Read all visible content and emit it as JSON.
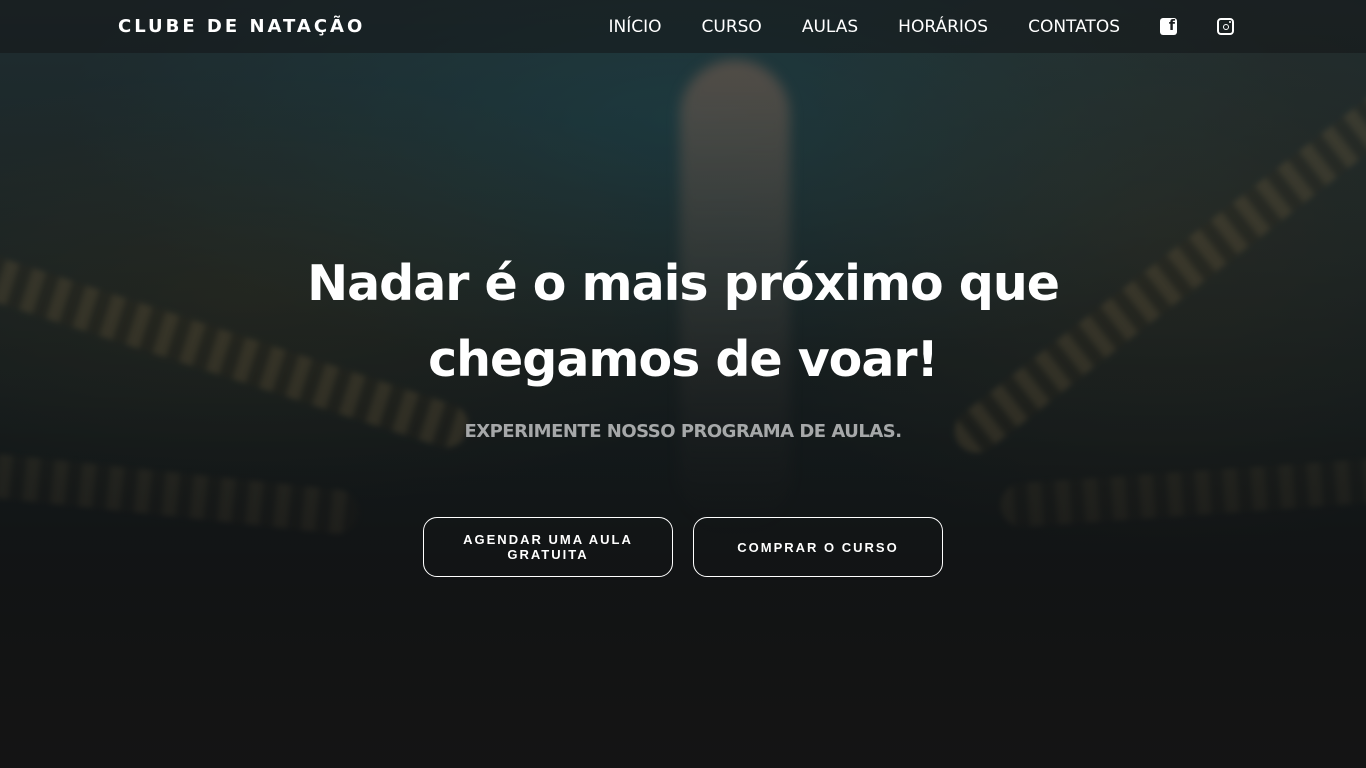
{
  "navbar": {
    "brand": "CLUBE DE NATAÇÃO",
    "links": [
      "INÍCIO",
      "CURSO",
      "AULAS",
      "HORÁRIOS",
      "CONTATOS"
    ],
    "social": [
      {
        "icon": "facebook-icon"
      },
      {
        "icon": "instagram-icon"
      }
    ]
  },
  "hero": {
    "headline_line1": "Nadar é o mais próximo que",
    "headline_line2": "chegamos de voar!",
    "subtitle": "EXPERIMENTE NOSSO PROGRAMA DE AULAS.",
    "buttons": {
      "primary": "AGENDAR UMA AULA GRATUITA",
      "secondary": "COMPRAR O CURSO"
    }
  },
  "colors": {
    "text": "#ffffff",
    "subtitle": "#a6a8a9",
    "background": "#161718"
  }
}
